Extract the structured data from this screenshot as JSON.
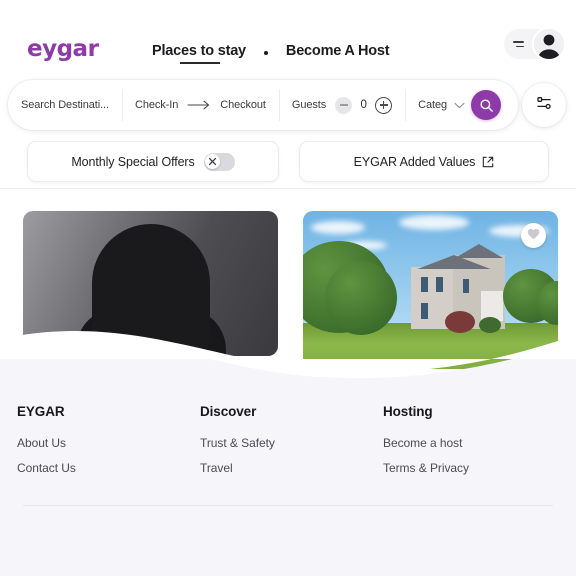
{
  "brand": {
    "logo_text": "eygar",
    "accent_color": "#8e3aa8"
  },
  "header": {
    "nav": [
      {
        "label": "Places to stay",
        "active": true
      },
      {
        "label": "Become A Host",
        "active": false
      }
    ],
    "user_menu": {
      "menu_icon": "hamburger-icon",
      "avatar_icon": "user-avatar-icon"
    }
  },
  "search": {
    "destination": {
      "value": "Search Destinati...",
      "placeholder": "Search Destination"
    },
    "check_in": {
      "label": "Check-In"
    },
    "arrow_icon": "arrow-right-icon",
    "checkout": {
      "label": "Checkout"
    },
    "guests": {
      "label": "Guests",
      "count": "0",
      "minus_icon": "minus-icon",
      "plus_icon": "plus-icon"
    },
    "category": {
      "label": "Categ",
      "chevron_icon": "chevron-down-icon"
    },
    "search_button_icon": "search-icon",
    "filters_button_icon": "sliders-icon"
  },
  "chips": [
    {
      "label": "Monthly Special Offers",
      "toggle": "off",
      "toggle_icon": "close-x-icon"
    },
    {
      "label": "EYGAR Added Values",
      "external_icon": "external-link-icon"
    }
  ],
  "cards": [
    {
      "name": "profile-placeholder-card",
      "image_alt": "avatar-silhouette",
      "favorite": false
    },
    {
      "name": "listing-card",
      "image_alt": "suburban-house-with-lawn",
      "favorite": true,
      "heart_icon": "heart-icon"
    }
  ],
  "footer": {
    "columns": [
      {
        "title": "EYGAR",
        "links": [
          "About Us",
          "Contact Us"
        ]
      },
      {
        "title": "Discover",
        "links": [
          "Trust & Safety",
          "Travel"
        ]
      },
      {
        "title": "Hosting",
        "links": [
          "Become a host",
          "Terms & Privacy"
        ]
      }
    ]
  }
}
